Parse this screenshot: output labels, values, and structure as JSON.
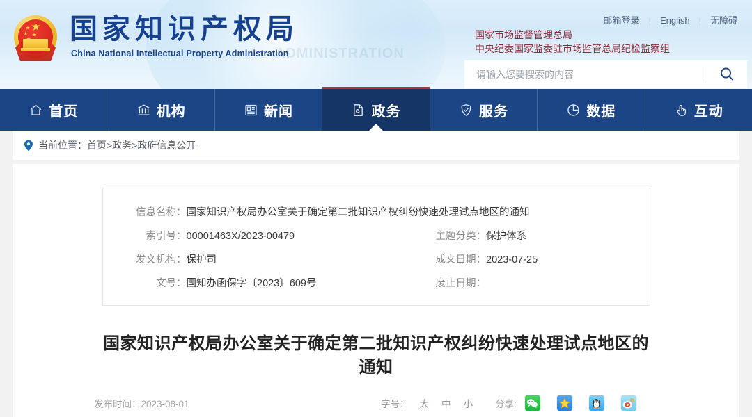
{
  "header": {
    "emblem_icon": "china-national-emblem",
    "site_title": "国家知识产权局",
    "site_subtitle": "China National Intellectual Property Administration",
    "watermark": "ADMINISTRATION",
    "top_links": [
      {
        "label": "邮箱登录"
      },
      {
        "label": "English"
      },
      {
        "label": "无障碍"
      }
    ],
    "org_lines": [
      "国家市场监督管理总局",
      "中央纪委国家监委驻市场监管总局纪检监察组"
    ],
    "search": {
      "placeholder": "请输入您要搜索的内容",
      "value": "",
      "button_icon": "search-icon"
    }
  },
  "nav": {
    "items": [
      {
        "label": "首页",
        "icon": "home-icon",
        "active": false
      },
      {
        "label": "机构",
        "icon": "bank-icon",
        "active": false
      },
      {
        "label": "新闻",
        "icon": "newspaper-icon",
        "active": false
      },
      {
        "label": "政务",
        "icon": "document-icon",
        "active": true
      },
      {
        "label": "服务",
        "icon": "shield-check-icon",
        "active": false
      },
      {
        "label": "数据",
        "icon": "pie-chart-icon",
        "active": false
      },
      {
        "label": "互动",
        "icon": "hand-pointer-icon",
        "active": false
      }
    ]
  },
  "breadcrumb": {
    "pin_icon": "location-pin-icon",
    "prefix": "当前位置：",
    "path": "首页>政务>政府信息公开"
  },
  "info_table": {
    "rows": [
      {
        "label": "信息名称：",
        "value": "国家知识产权局办公室关于确定第二批知识产权纠纷快速处理试点地区的通知"
      },
      {
        "label": "索引号：",
        "value": "00001463X/2023-00479",
        "label2": "主题分类：",
        "value2": "保护体系"
      },
      {
        "label": "发文机构：",
        "value": "保护司",
        "label2": "成文日期：",
        "value2": "2023-07-25"
      },
      {
        "label": "文号：",
        "value": "国知办函保字〔2023〕609号",
        "label2": "废止日期：",
        "value2": ""
      }
    ]
  },
  "document": {
    "title": "国家知识产权局办公室关于确定第二批知识产权纠纷快速处理试点地区的通知",
    "publish_label": "发布时间：",
    "publish_date": "2023-08-01",
    "font_size": {
      "label": "字号：",
      "options": [
        "大",
        "中",
        "小"
      ]
    },
    "share": {
      "label": "分享:",
      "items": [
        {
          "name": "wechat",
          "icon": "wechat-icon"
        },
        {
          "name": "favorite",
          "icon": "star-favorite-icon"
        },
        {
          "name": "qq",
          "icon": "qq-penguin-icon"
        },
        {
          "name": "weibo",
          "icon": "weibo-eye-icon"
        }
      ]
    }
  },
  "colors": {
    "nav_blue": "#1c4585",
    "nav_active_blue": "#143566",
    "accent_red": "#b03434",
    "title_blue": "#16418f",
    "org_red": "#8b2a36",
    "page_bg": "#f2f2f2"
  }
}
